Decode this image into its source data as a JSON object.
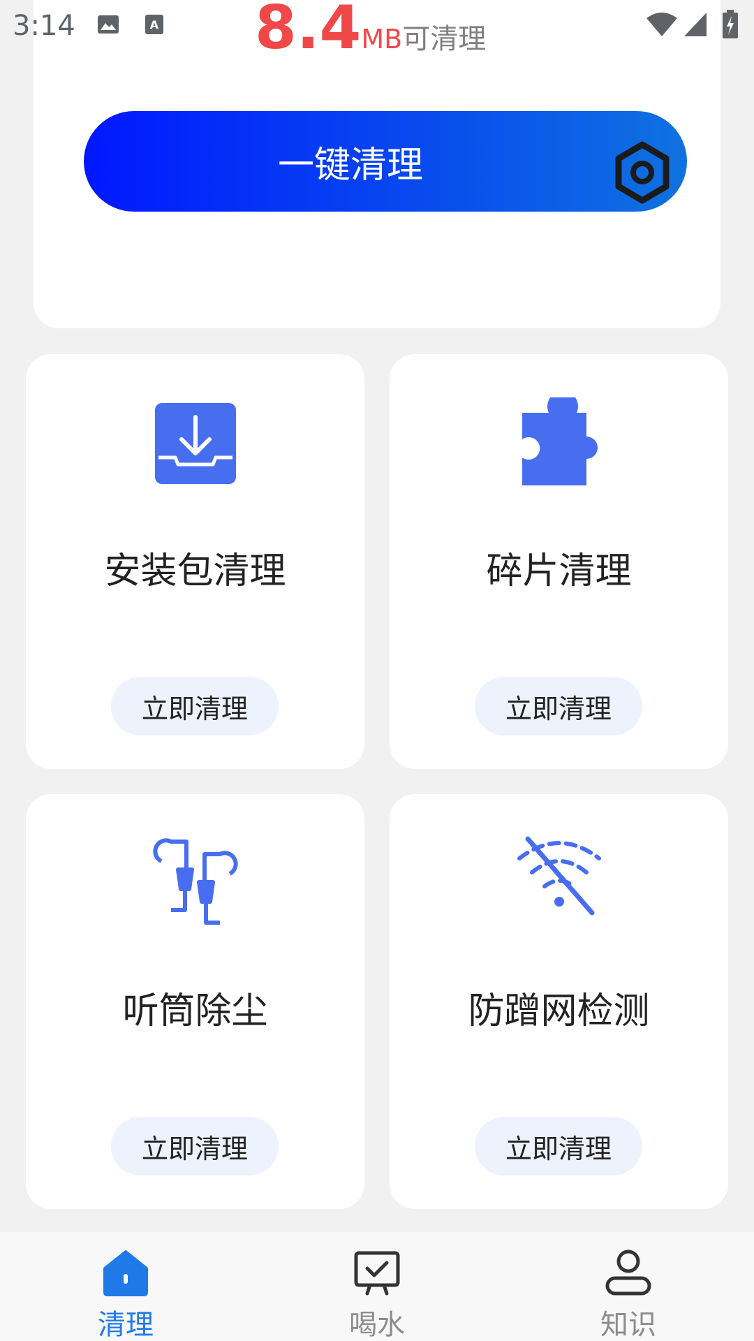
{
  "status_bar": {
    "time": "3:14"
  },
  "summary": {
    "amount": "8.4",
    "unit": "MB",
    "suffix": "可清理"
  },
  "one_click": {
    "label": "一键清理"
  },
  "features": [
    {
      "title": "安装包清理",
      "button": "立即清理",
      "icon": "download-tray-icon"
    },
    {
      "title": "碎片清理",
      "button": "立即清理",
      "icon": "puzzle-piece-icon"
    },
    {
      "title": "听筒除尘",
      "button": "立即清理",
      "icon": "earphones-icon"
    },
    {
      "title": "防蹭网检测",
      "button": "立即清理",
      "icon": "wifi-off-icon"
    }
  ],
  "bottom_nav": [
    {
      "label": "清理",
      "icon": "home-icon",
      "active": true
    },
    {
      "label": "喝水",
      "icon": "monitor-check-icon",
      "active": false
    },
    {
      "label": "知识",
      "icon": "person-icon",
      "active": false
    }
  ],
  "colors": {
    "accent": "#1f7ae8",
    "icon_blue": "#486ef0",
    "amount_red": "#f04848",
    "nav_inactive": "#8c8c8c"
  }
}
